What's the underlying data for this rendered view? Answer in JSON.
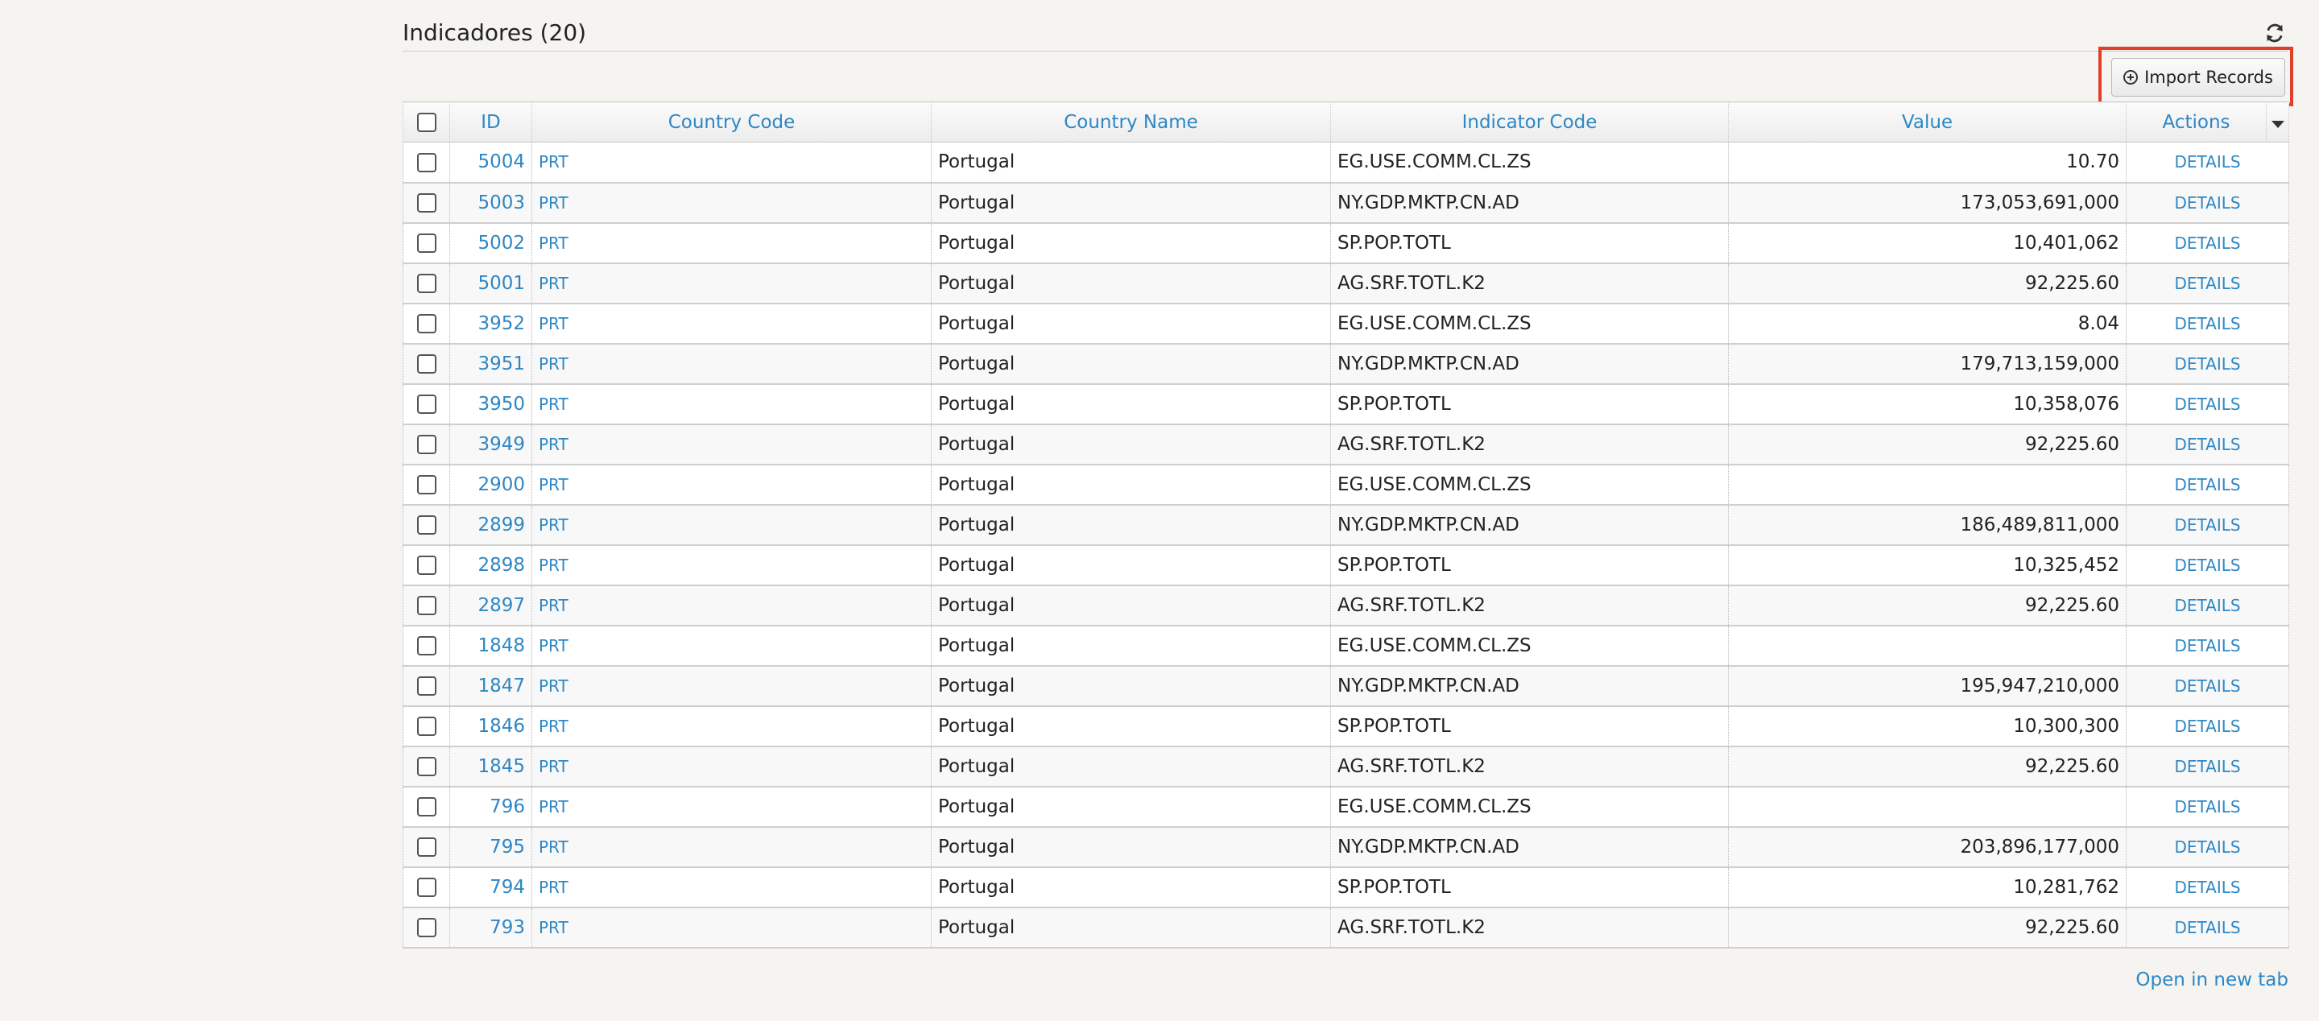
{
  "panel": {
    "title": "Indicadores (20)",
    "refresh_icon": "refresh-icon",
    "import_button_label": "Import Records",
    "import_icon": "plus-circle-icon",
    "open_new_tab_label": "Open in new tab",
    "highlight_color": "#e0402b",
    "link_color": "#2e87c4"
  },
  "table": {
    "columns": [
      "ID",
      "Country Code",
      "Country Name",
      "Indicator Code",
      "Value",
      "Actions"
    ],
    "rows": [
      {
        "id": "5004",
        "country_code": "PRT",
        "country_name": "Portugal",
        "indicator_code": "EG.USE.COMM.CL.ZS",
        "value": "10.70",
        "action": "DETAILS"
      },
      {
        "id": "5003",
        "country_code": "PRT",
        "country_name": "Portugal",
        "indicator_code": "NY.GDP.MKTP.CN.AD",
        "value": "173,053,691,000",
        "action": "DETAILS"
      },
      {
        "id": "5002",
        "country_code": "PRT",
        "country_name": "Portugal",
        "indicator_code": "SP.POP.TOTL",
        "value": "10,401,062",
        "action": "DETAILS"
      },
      {
        "id": "5001",
        "country_code": "PRT",
        "country_name": "Portugal",
        "indicator_code": "AG.SRF.TOTL.K2",
        "value": "92,225.60",
        "action": "DETAILS"
      },
      {
        "id": "3952",
        "country_code": "PRT",
        "country_name": "Portugal",
        "indicator_code": "EG.USE.COMM.CL.ZS",
        "value": "8.04",
        "action": "DETAILS"
      },
      {
        "id": "3951",
        "country_code": "PRT",
        "country_name": "Portugal",
        "indicator_code": "NY.GDP.MKTP.CN.AD",
        "value": "179,713,159,000",
        "action": "DETAILS"
      },
      {
        "id": "3950",
        "country_code": "PRT",
        "country_name": "Portugal",
        "indicator_code": "SP.POP.TOTL",
        "value": "10,358,076",
        "action": "DETAILS"
      },
      {
        "id": "3949",
        "country_code": "PRT",
        "country_name": "Portugal",
        "indicator_code": "AG.SRF.TOTL.K2",
        "value": "92,225.60",
        "action": "DETAILS"
      },
      {
        "id": "2900",
        "country_code": "PRT",
        "country_name": "Portugal",
        "indicator_code": "EG.USE.COMM.CL.ZS",
        "value": "",
        "action": "DETAILS"
      },
      {
        "id": "2899",
        "country_code": "PRT",
        "country_name": "Portugal",
        "indicator_code": "NY.GDP.MKTP.CN.AD",
        "value": "186,489,811,000",
        "action": "DETAILS"
      },
      {
        "id": "2898",
        "country_code": "PRT",
        "country_name": "Portugal",
        "indicator_code": "SP.POP.TOTL",
        "value": "10,325,452",
        "action": "DETAILS"
      },
      {
        "id": "2897",
        "country_code": "PRT",
        "country_name": "Portugal",
        "indicator_code": "AG.SRF.TOTL.K2",
        "value": "92,225.60",
        "action": "DETAILS"
      },
      {
        "id": "1848",
        "country_code": "PRT",
        "country_name": "Portugal",
        "indicator_code": "EG.USE.COMM.CL.ZS",
        "value": "",
        "action": "DETAILS"
      },
      {
        "id": "1847",
        "country_code": "PRT",
        "country_name": "Portugal",
        "indicator_code": "NY.GDP.MKTP.CN.AD",
        "value": "195,947,210,000",
        "action": "DETAILS"
      },
      {
        "id": "1846",
        "country_code": "PRT",
        "country_name": "Portugal",
        "indicator_code": "SP.POP.TOTL",
        "value": "10,300,300",
        "action": "DETAILS"
      },
      {
        "id": "1845",
        "country_code": "PRT",
        "country_name": "Portugal",
        "indicator_code": "AG.SRF.TOTL.K2",
        "value": "92,225.60",
        "action": "DETAILS"
      },
      {
        "id": "796",
        "country_code": "PRT",
        "country_name": "Portugal",
        "indicator_code": "EG.USE.COMM.CL.ZS",
        "value": "",
        "action": "DETAILS"
      },
      {
        "id": "795",
        "country_code": "PRT",
        "country_name": "Portugal",
        "indicator_code": "NY.GDP.MKTP.CN.AD",
        "value": "203,896,177,000",
        "action": "DETAILS"
      },
      {
        "id": "794",
        "country_code": "PRT",
        "country_name": "Portugal",
        "indicator_code": "SP.POP.TOTL",
        "value": "10,281,762",
        "action": "DETAILS"
      },
      {
        "id": "793",
        "country_code": "PRT",
        "country_name": "Portugal",
        "indicator_code": "AG.SRF.TOTL.K2",
        "value": "92,225.60",
        "action": "DETAILS"
      }
    ]
  }
}
